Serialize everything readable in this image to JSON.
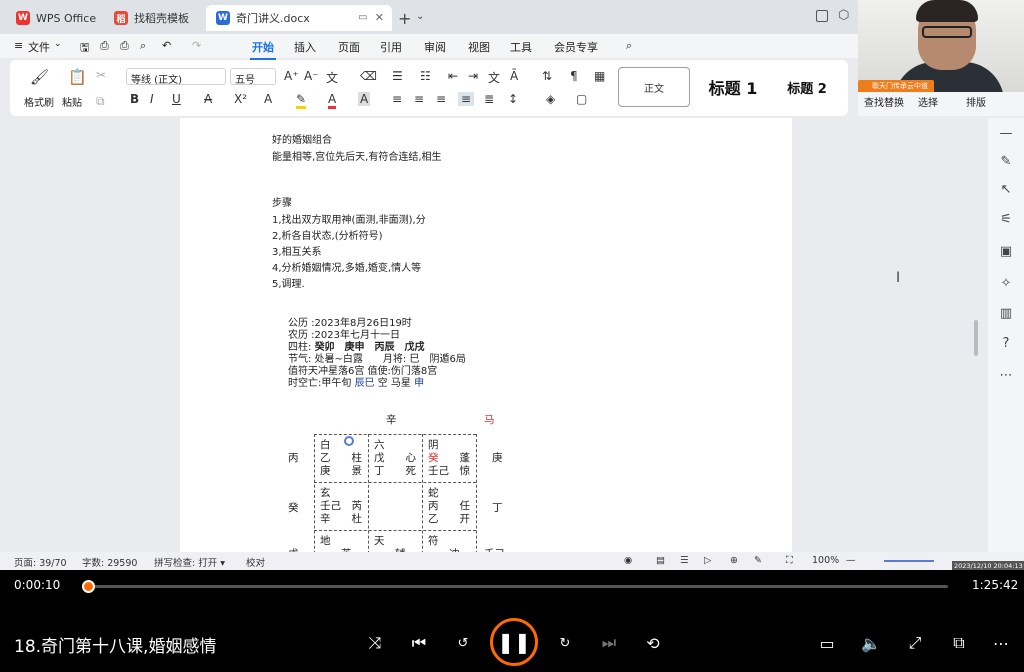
{
  "tabs": [
    {
      "label": "WPS Office"
    },
    {
      "label": "找稻壳模板"
    },
    {
      "label": "奇门讲义.docx"
    }
  ],
  "menu": {
    "file": "文件",
    "items": [
      "开始",
      "插入",
      "页面",
      "引用",
      "审阅",
      "视图",
      "工具",
      "会员专享"
    ]
  },
  "ribbon": {
    "format_painter": "格式刷",
    "paste": "粘贴",
    "font_name": "等线 (正文)",
    "font_size": "五号",
    "styles": {
      "normal": "正文",
      "h1": "标题 1",
      "h2": "标题 2"
    },
    "find_replace": "查找替换",
    "select": "选择",
    "arrange": "排版"
  },
  "webcam": {
    "caption": "歌天门传承云中道"
  },
  "doc": {
    "lines": [
      "好的婚姻组合",
      "能量相等,宫位先后天,有符合连结,相生",
      "步骤",
      "1,找出双方取用神(面测,非面测),分",
      "2,析各自状态,(分析符号)",
      "3,相互关系",
      "4,分析婚姻情况,多婚,婚变,情人等",
      "5,调理."
    ],
    "chart": {
      "gongli": "公历 :2023年8月26日19时",
      "nongli": "农历 :2023年七月十一日",
      "sizhu_label": "四柱:",
      "sizhu": "癸卯　庚申　丙辰　戊戌",
      "jieqi": "节气: 处暑~白露　　月将: 巳　阴遁6局",
      "zhifu": "值符天冲星落6宫  值使:伤门落8宫",
      "kongwang_a": "时空亡:甲午旬 ",
      "kongwang_b": "辰巳",
      "kongwang_c": " 空  马星 ",
      "kongwang_d": "申"
    },
    "board": {
      "top": "辛",
      "ma": "马",
      "left1": "丙",
      "right1": "庚",
      "left2": "癸",
      "right2": "丁",
      "left3": "戊",
      "right3": "壬己",
      "c11a": "白",
      "c11b": "乙　　柱",
      "c11c": "庚　　景",
      "c12a": "六",
      "c12b": "戊　　心",
      "c12c": "丁　　死",
      "c13a": "阴",
      "c13b": "癸",
      "c13b2": "　　蓬",
      "c13c": "壬己　惊",
      "c21a": "玄",
      "c21b": "壬己　芮",
      "c21c": "辛　　杜",
      "c23a": "蛇",
      "c23b": "丙　　任",
      "c23c": "乙　　开",
      "c31a": "地",
      "c31b": "　　英",
      "c32a": "天",
      "c32b": "　　辅",
      "c33a": "符",
      "c33b": "　　冲"
    }
  },
  "status": {
    "page": "页面: 39/70",
    "words": "字数: 29590",
    "spell": "拼写检查: 打开 ▾",
    "proof": "校对",
    "zoom": "100%"
  },
  "screen_timestamp": "2023/12/10 20:04:13",
  "player": {
    "current": "0:00:10",
    "total": "1:25:42",
    "progress_fraction": 0.002,
    "title": "18.奇门第十八课,婚姻感情"
  },
  "colors": {
    "accent": "#1a73e8",
    "player_accent": "#ff6a00",
    "webcam_label": "#ee7d1b"
  }
}
